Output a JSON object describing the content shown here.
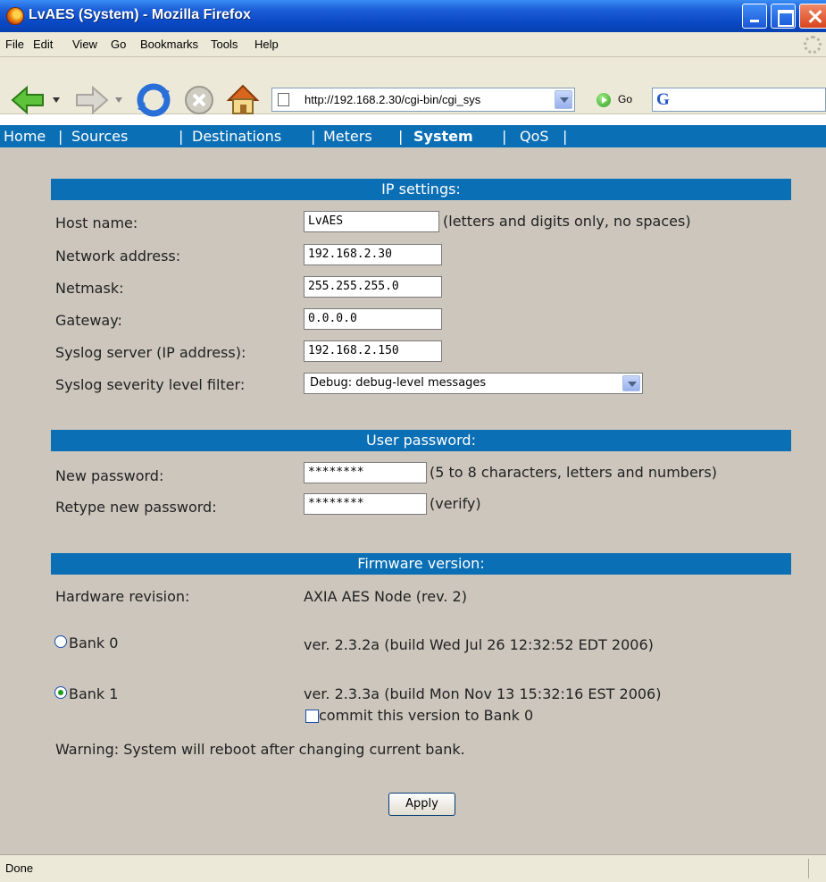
{
  "window": {
    "title": "LvAES (System) - Mozilla Firefox"
  },
  "menu": {
    "items": [
      "File",
      "Edit",
      "View",
      "Go",
      "Bookmarks",
      "Tools",
      "Help"
    ]
  },
  "toolbar": {
    "url": "http://192.168.2.30/cgi-bin/cgi_sys",
    "go_label": "Go",
    "search_placeholder": ""
  },
  "nav": {
    "home": "Home",
    "sources": "Sources",
    "destinations": "Destinations",
    "meters": "Meters",
    "system": "System",
    "qos": "QoS",
    "sep": "|",
    "active": "System"
  },
  "ip_settings": {
    "header": "IP settings:",
    "host_label": "Host name:",
    "host_value": "LvAES",
    "host_hint": "(letters and digits only, no spaces)",
    "network_label": "Network address:",
    "network_value": "192.168.2.30",
    "netmask_label": "Netmask:",
    "netmask_value": "255.255.255.0",
    "gateway_label": "Gateway:",
    "gateway_value": "0.0.0.0",
    "syslog_label": "Syslog server (IP address):",
    "syslog_value": "192.168.2.150",
    "severity_label": "Syslog severity level filter:",
    "severity_value": "Debug: debug-level messages"
  },
  "password": {
    "header": "User password:",
    "new_label": "New password:",
    "new_value": "********",
    "new_hint": "(5 to 8 characters, letters and numbers)",
    "retype_label": "Retype new password:",
    "retype_value": "********",
    "retype_hint": "(verify)"
  },
  "firmware": {
    "header": "Firmware version:",
    "hw_label": "Hardware revision:",
    "hw_value": "AXIA AES Node (rev. 2)",
    "bank0_label": "Bank 0",
    "bank0_version": "ver. 2.3.2a (build Wed Jul 26 12:32:52 EDT 2006)",
    "bank0_selected": false,
    "bank1_label": "Bank 1",
    "bank1_version": "ver. 2.3.3a (build Mon Nov 13 15:32:16 EST 2006)",
    "bank1_selected": true,
    "commit_label": "commit this version to Bank 0",
    "commit_checked": false,
    "warning": "Warning: System will reboot after changing current bank."
  },
  "apply_label": "Apply",
  "status": {
    "text": "Done"
  },
  "colors": {
    "nav_blue": "#0b6fb5",
    "content_bg": "#ccc6bd",
    "chrome_bg": "#ece9d8",
    "titlebar_blue": "#0a48c4"
  },
  "icons": [
    "firefox-logo-icon",
    "back-arrow-icon",
    "forward-arrow-icon",
    "reload-icon",
    "stop-icon",
    "home-icon",
    "page-icon",
    "go-icon",
    "google-icon",
    "throbber-icon"
  ]
}
